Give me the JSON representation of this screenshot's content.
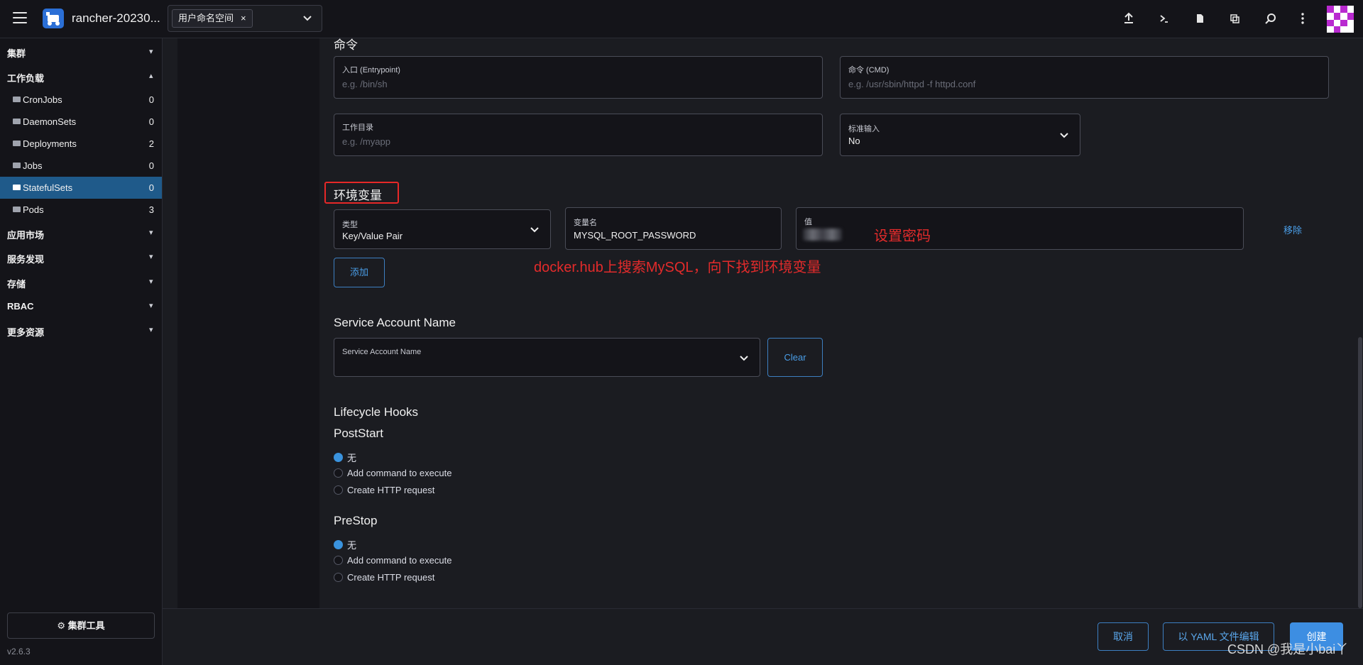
{
  "header": {
    "cluster_name": "rancher-20230...",
    "namespace_chip": "用户命名空间",
    "chip_close": "×"
  },
  "sidebar": {
    "groups": {
      "cluster": "集群",
      "workloads": "工作负载",
      "apps": "应用市场",
      "service_discovery": "服务发现",
      "storage": "存储",
      "rbac": "RBAC",
      "more": "更多资源"
    },
    "items": [
      {
        "label": "CronJobs",
        "count": "0"
      },
      {
        "label": "DaemonSets",
        "count": "0"
      },
      {
        "label": "Deployments",
        "count": "2"
      },
      {
        "label": "Jobs",
        "count": "0"
      },
      {
        "label": "StatefulSets",
        "count": "0"
      },
      {
        "label": "Pods",
        "count": "3"
      }
    ],
    "cluster_tools": "集群工具",
    "version": "v2.6.3"
  },
  "form": {
    "command_section": "命令",
    "entrypoint_label": "入口 (Entrypoint)",
    "entrypoint_placeholder": "e.g. /bin/sh",
    "cmd_label": "命令 (CMD)",
    "cmd_placeholder": "e.g. /usr/sbin/httpd -f httpd.conf",
    "workdir_label": "工作目录",
    "workdir_placeholder": "e.g. /myapp",
    "stdin_label": "标准输入",
    "stdin_value": "No",
    "env_section": "环境变量",
    "type_label": "类型",
    "type_value": "Key/Value Pair",
    "var_name_label": "变量名",
    "var_name_value": "MYSQL_ROOT_PASSWORD",
    "value_label": "值",
    "remove": "移除",
    "add": "添加",
    "sa_section": "Service Account Name",
    "sa_label": "Service Account Name",
    "clear": "Clear",
    "lifecycle": "Lifecycle Hooks",
    "poststart": "PostStart",
    "prestop": "PreStop",
    "options": [
      "无",
      "Add command to execute",
      "Create HTTP request"
    ]
  },
  "annotations": {
    "set_password": "设置密码",
    "hint": "docker.hub上搜索MySQL，向下找到环境变量"
  },
  "footer": {
    "cancel": "取消",
    "yaml_edit": "以 YAML 文件编辑",
    "create": "创建"
  },
  "watermark": "CSDN @我是小bai丫"
}
